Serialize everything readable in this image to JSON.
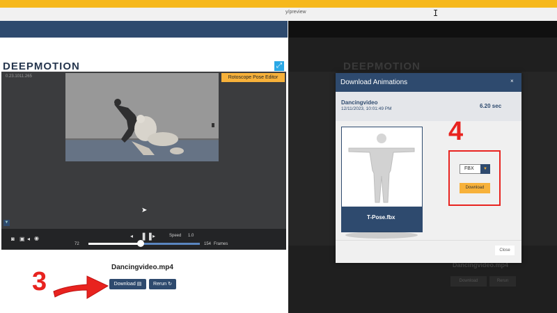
{
  "browser": {
    "url_fragment": "y/preview"
  },
  "logo": {
    "text": "DEEPMOTION"
  },
  "viewer": {
    "version": "0.23.1011.265",
    "rotoscope_label": "Rotoscope Pose Editor",
    "speed_label": "Speed",
    "speed_value": "1.0",
    "frame_current": "72",
    "frame_total": "154",
    "frames_label": "Frames",
    "playback_progress": 0.47
  },
  "job": {
    "filename": "Dancingvideo.mp4",
    "download_label": "Download",
    "rerun_label": "Rerun"
  },
  "annotations": {
    "step_left": "3",
    "step_right": "4",
    "accent_color": "#e8231f"
  },
  "modal": {
    "title": "Download Animations",
    "close_symbol": "×",
    "video_name": "Dancingvideo",
    "video_date": "12/11/2023, 10:01:49 PM",
    "duration": "6.20 sec",
    "preview_label": "T-Pose.fbx",
    "format_value": "FBX",
    "download_label": "Download",
    "close_label": "Close"
  },
  "colors": {
    "brand": "#2e4a6e",
    "accent": "#f7b13a",
    "topbar": "#f6b81c"
  }
}
